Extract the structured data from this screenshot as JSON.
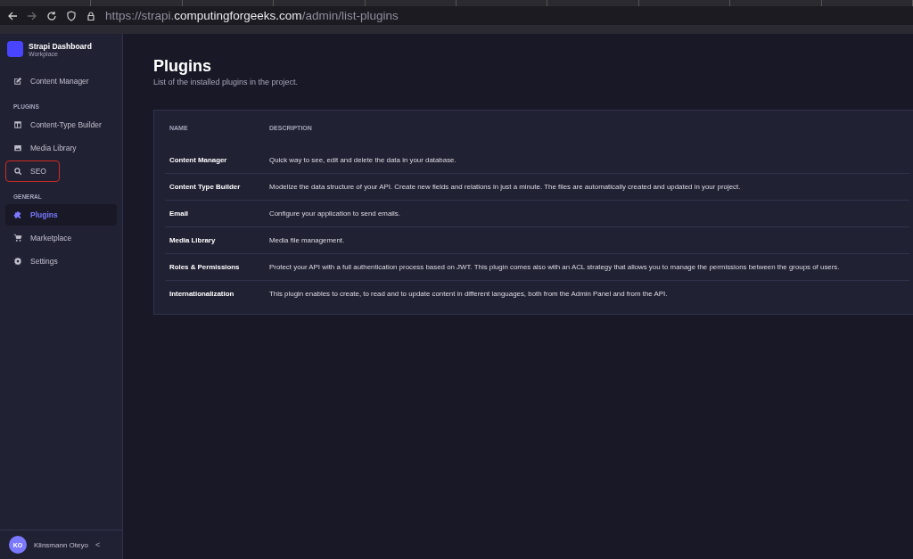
{
  "browser": {
    "url_host": "https://strapi.",
    "url_domain": "computingforgeeks.com",
    "url_path": "/admin/list-plugins"
  },
  "sidebar": {
    "title": "Strapi Dashboard",
    "subtitle": "Workplace",
    "sections": [
      {
        "items": [
          {
            "label": "Content Manager",
            "selected": false,
            "highlighted": false
          }
        ]
      },
      {
        "heading": "PLUGINS",
        "items": [
          {
            "label": "Content-Type Builder",
            "selected": false,
            "highlighted": false
          },
          {
            "label": "Media Library",
            "selected": false,
            "highlighted": false
          },
          {
            "label": "SEO",
            "selected": false,
            "highlighted": true
          }
        ]
      },
      {
        "heading": "GENERAL",
        "items": [
          {
            "label": "Plugins",
            "selected": true,
            "highlighted": false
          },
          {
            "label": "Marketplace",
            "selected": false,
            "highlighted": false
          },
          {
            "label": "Settings",
            "selected": false,
            "highlighted": false
          }
        ]
      }
    ],
    "user": {
      "initials": "KO",
      "name": "Klinsmann Oteyo",
      "collapse": "<"
    }
  },
  "page": {
    "title": "Plugins",
    "subtitle": "List of the installed plugins in the project."
  },
  "table": {
    "columns": [
      "NAME",
      "DESCRIPTION"
    ],
    "rows": [
      [
        "Content Manager",
        "Quick way to see, edit and delete the data in your database."
      ],
      [
        "Content Type Builder",
        "Modelize the data structure of your API. Create new fields and relations in just a minute. The files are automatically created and updated in your project."
      ],
      [
        "Email",
        "Configure your application to send emails."
      ],
      [
        "Media Library",
        "Media file management."
      ],
      [
        "Roles & Permissions",
        "Protect your API with a full authentication process based on JWT. This plugin comes also with an ACL strategy that allows you to manage the permissions between the groups of users."
      ],
      [
        "Internationalization",
        "This plugin enables to create, to read and to update content in different languages, both from the Admin Panel and from the API."
      ]
    ]
  }
}
